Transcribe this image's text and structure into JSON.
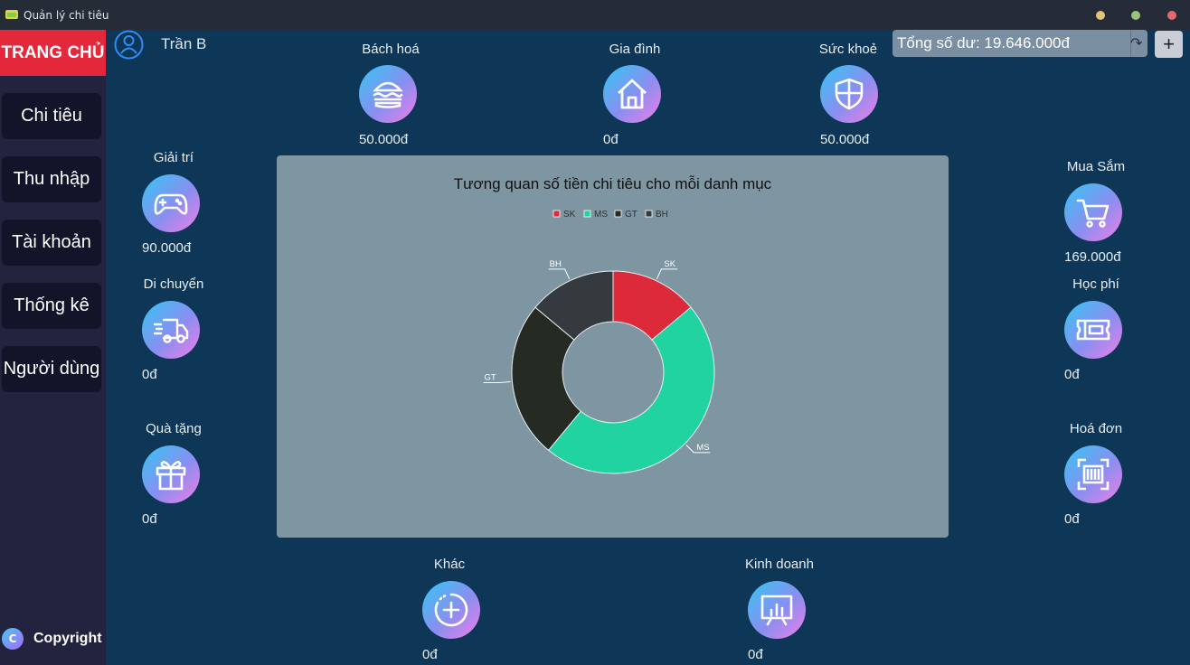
{
  "window": {
    "title": "Quản lý chi tiêu"
  },
  "sidebar": {
    "home_label": "TRANG CHỦ",
    "items": [
      {
        "label": "Chi tiêu"
      },
      {
        "label": "Thu nhập"
      },
      {
        "label": "Tài khoản"
      },
      {
        "label": "Thống kê"
      },
      {
        "label": "Người dùng"
      }
    ],
    "copyright_icon": "C",
    "copyright_label": "Copyright"
  },
  "user": {
    "name": "Trần B",
    "icon": "user-icon"
  },
  "balance": {
    "text": "Tổng số dư: 19.646.000đ",
    "add_label": "+"
  },
  "categories": {
    "bach_hoa": {
      "label": "Bách hoá",
      "amount": "50.000đ",
      "icon": "burger-icon"
    },
    "gia_dinh": {
      "label": "Gia đình",
      "amount": "0đ",
      "icon": "house-icon"
    },
    "suc_khoe": {
      "label": "Sức khoẻ",
      "amount": "50.000đ",
      "icon": "shield-icon"
    },
    "giai_tri": {
      "label": "Giải trí",
      "amount": "90.000đ",
      "icon": "gamepad-icon"
    },
    "di_chuyen": {
      "label": "Di chuyển",
      "amount": "0đ",
      "icon": "truck-icon"
    },
    "qua_tang": {
      "label": "Quà tặng",
      "amount": "0đ",
      "icon": "gift-icon"
    },
    "mua_sam": {
      "label": "Mua Sắm",
      "amount": "169.000đ",
      "icon": "cart-icon"
    },
    "hoc_phi": {
      "label": "Học phí",
      "amount": "0đ",
      "icon": "ticket-icon"
    },
    "hoa_don": {
      "label": "Hoá đơn",
      "amount": "0đ",
      "icon": "barcode-icon"
    },
    "khac": {
      "label": "Khác",
      "amount": "0đ",
      "icon": "plus-circle-icon"
    },
    "kinh_doanh": {
      "label": "Kinh doanh",
      "amount": "0đ",
      "icon": "chart-board-icon"
    }
  },
  "chart_data": {
    "type": "pie",
    "donut": true,
    "title": "Tương quan số tiền chi tiêu cho mỗi danh mục",
    "legend_position": "top",
    "slices": [
      {
        "name": "SK",
        "value": 50000,
        "color": "#dc2a3b"
      },
      {
        "name": "MS",
        "value": 169000,
        "color": "#21d3a0"
      },
      {
        "name": "GT",
        "value": 90000,
        "color": "#252a22"
      },
      {
        "name": "BH",
        "value": 50000,
        "color": "#353a3f"
      }
    ]
  },
  "colors": {
    "background": "#0d3657",
    "sidebar": "#22233f",
    "home_button": "#e4283b",
    "chart_panel": "#7e95a2"
  }
}
